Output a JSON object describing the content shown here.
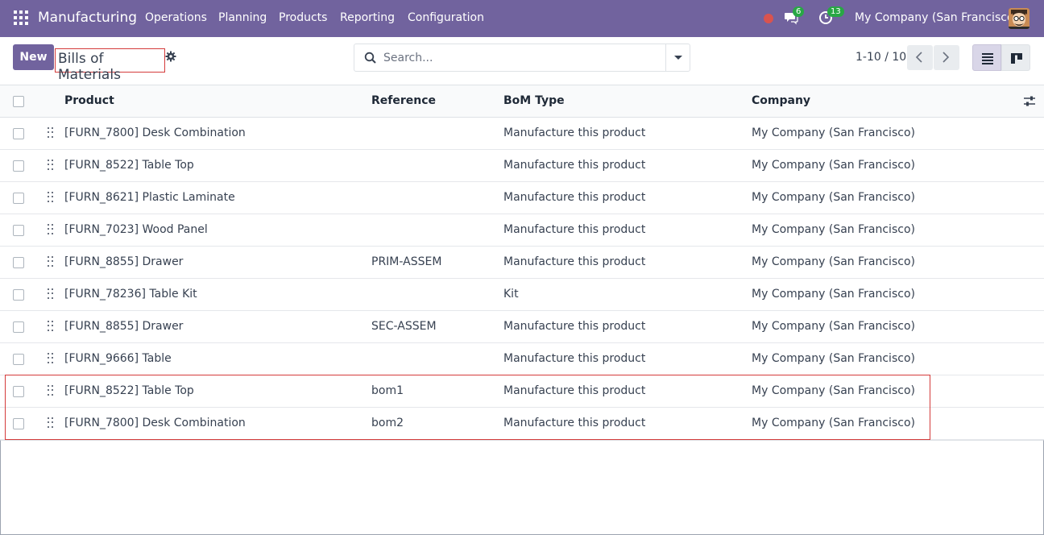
{
  "navbar": {
    "app_name": "Manufacturing",
    "menu": [
      "Operations",
      "Planning",
      "Products",
      "Reporting",
      "Configuration"
    ],
    "messages_count": "6",
    "activities_count": "13",
    "company": "My Company (San Francisco)",
    "accent": "#71639e"
  },
  "control_panel": {
    "new_label": "New",
    "title": "Bills of Materials",
    "search_placeholder": "Search...",
    "pager": "1-10 / 10"
  },
  "table": {
    "columns": [
      "Product",
      "Reference",
      "BoM Type",
      "Company"
    ],
    "rows": [
      {
        "product": "[FURN_7800] Desk Combination",
        "reference": "",
        "type": "Manufacture this product",
        "company": "My Company (San Francisco)"
      },
      {
        "product": "[FURN_8522] Table Top",
        "reference": "",
        "type": "Manufacture this product",
        "company": "My Company (San Francisco)"
      },
      {
        "product": "[FURN_8621] Plastic Laminate",
        "reference": "",
        "type": "Manufacture this product",
        "company": "My Company (San Francisco)"
      },
      {
        "product": "[FURN_7023] Wood Panel",
        "reference": "",
        "type": "Manufacture this product",
        "company": "My Company (San Francisco)"
      },
      {
        "product": "[FURN_8855] Drawer",
        "reference": "PRIM-ASSEM",
        "type": "Manufacture this product",
        "company": "My Company (San Francisco)"
      },
      {
        "product": "[FURN_78236] Table Kit",
        "reference": "",
        "type": "Kit",
        "company": "My Company (San Francisco)"
      },
      {
        "product": "[FURN_8855] Drawer",
        "reference": "SEC-ASSEM",
        "type": "Manufacture this product",
        "company": "My Company (San Francisco)"
      },
      {
        "product": "[FURN_9666] Table",
        "reference": "",
        "type": "Manufacture this product",
        "company": "My Company (San Francisco)"
      },
      {
        "product": "[FURN_8522] Table Top",
        "reference": "bom1",
        "type": "Manufacture this product",
        "company": "My Company (San Francisco)"
      },
      {
        "product": "[FURN_7800] Desk Combination",
        "reference": "bom2",
        "type": "Manufacture this product",
        "company": "My Company (San Francisco)"
      }
    ]
  }
}
